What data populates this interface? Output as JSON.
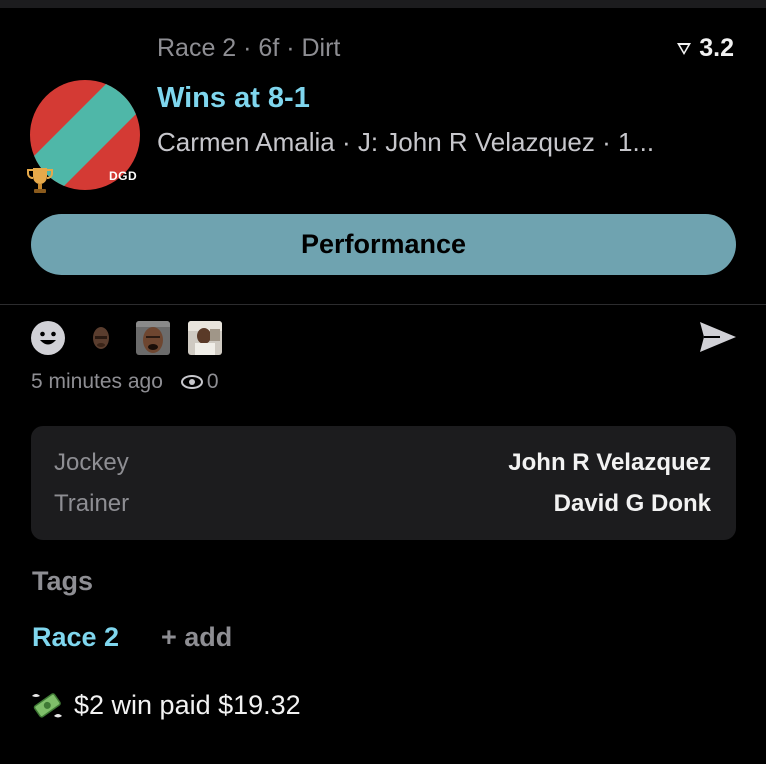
{
  "post": {
    "race_line": "Race 2 · 6f · Dirt",
    "rating": "3.2",
    "headline": "Wins at 8-1",
    "sub_line": "Carmen Amalia · J: John R Velazquez · 1...",
    "silk_initials": "DGD",
    "performance_label": "Performance"
  },
  "reactions": {
    "icons": [
      "smiley-face-icon",
      "reaction-face-1",
      "reaction-face-2",
      "reaction-face-3"
    ],
    "send_icon": "send-icon"
  },
  "meta": {
    "time": "5 minutes ago",
    "views": "0"
  },
  "details": {
    "jockey_label": "Jockey",
    "jockey_value": "John R Velazquez",
    "trainer_label": "Trainer",
    "trainer_value": "David G Donk"
  },
  "tags": {
    "title": "Tags",
    "items": [
      "Race 2"
    ],
    "add_label": "+ add"
  },
  "payout": {
    "text": "$2 win paid $19.32"
  },
  "colors": {
    "accent": "#7fd6ee",
    "button": "#6fa3b0",
    "silk_red": "#d43a34",
    "silk_teal": "#4fb7a8"
  }
}
